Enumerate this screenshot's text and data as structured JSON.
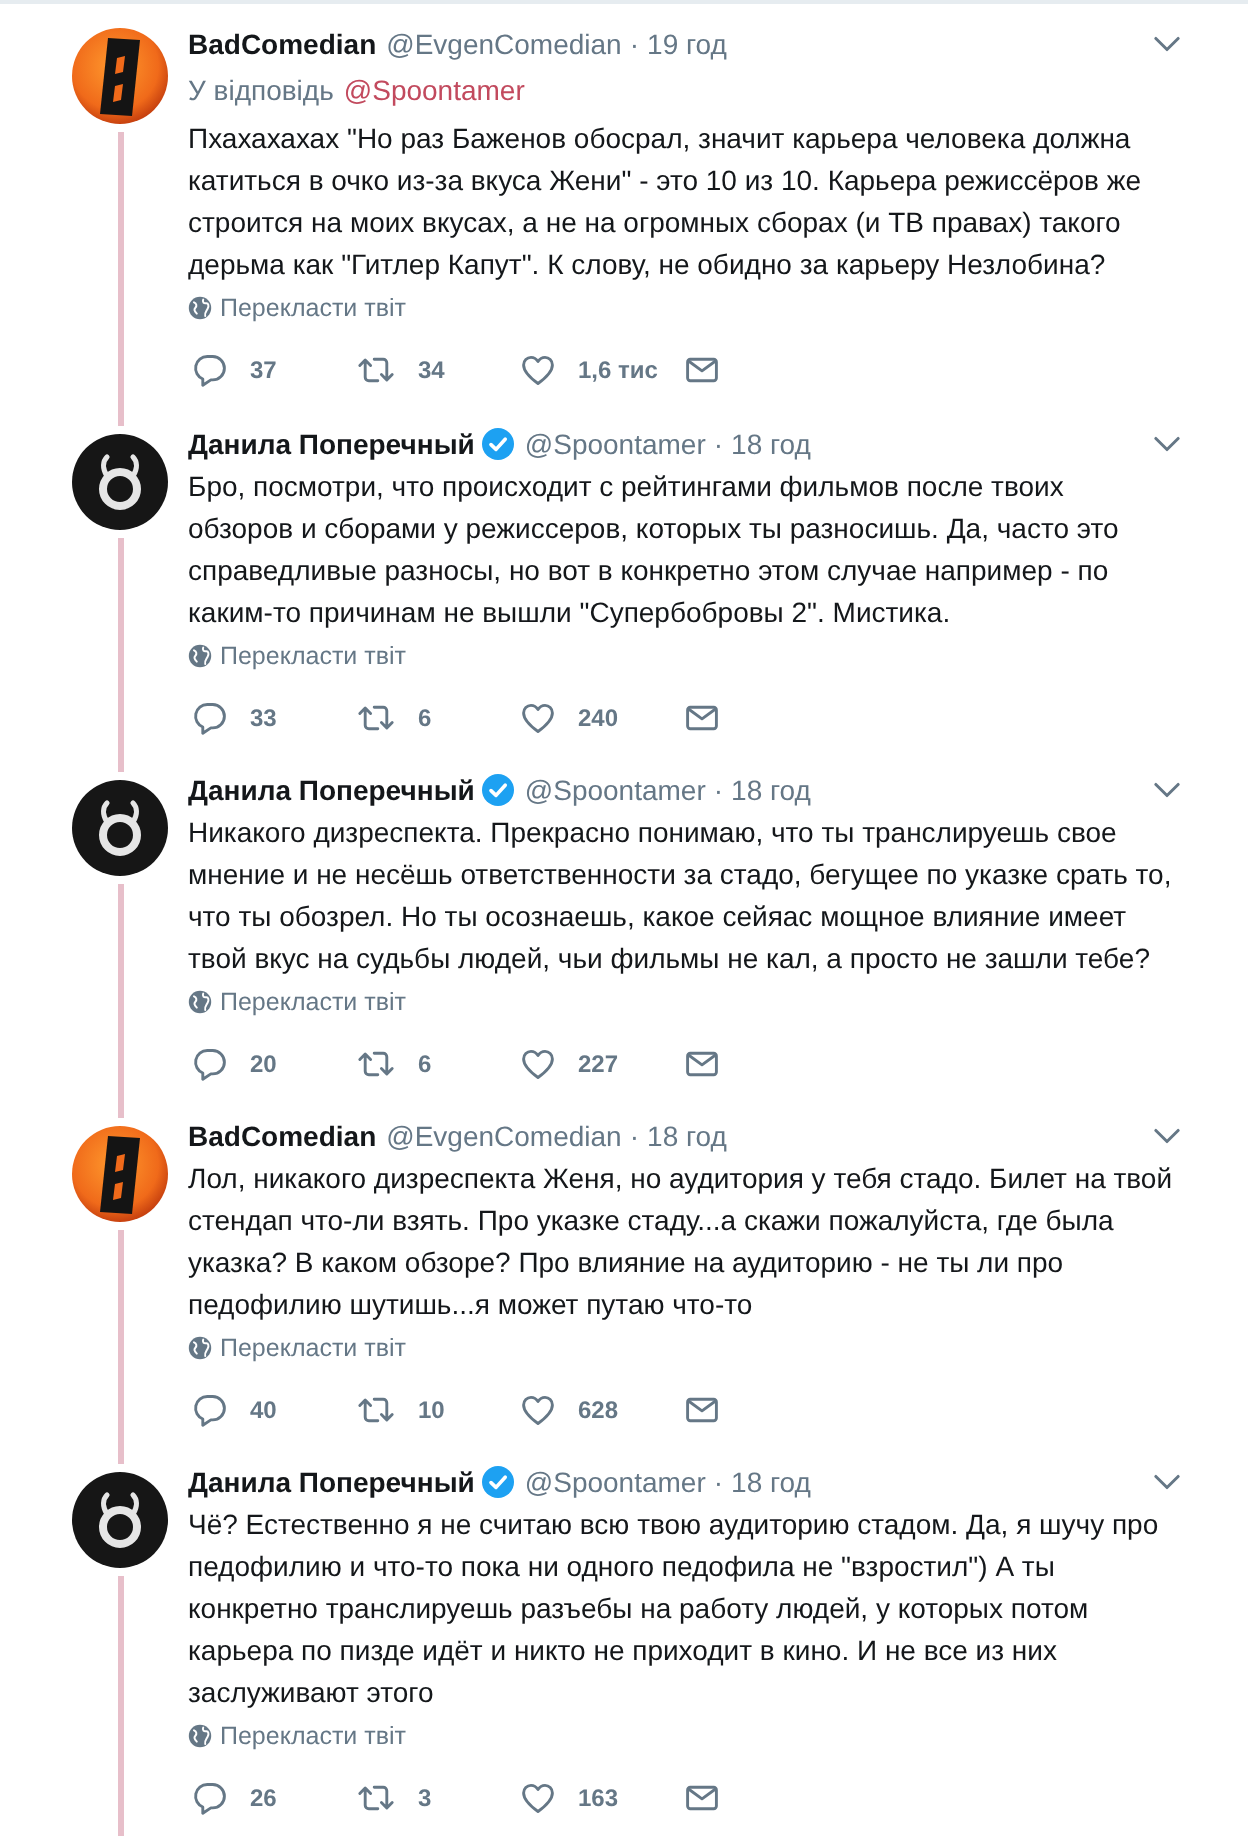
{
  "tweets": [
    {
      "avatar": {
        "kind": "orange-block"
      },
      "name": "BadComedian",
      "verified": false,
      "handle": "@EvgenComedian",
      "dot": "·",
      "time": "19 год",
      "reply_to": {
        "label": "У відповідь",
        "mention": "@Spoontamer"
      },
      "text": "Пхахахахах \"Но раз Баженов обосрал, значит карьера человека должна катиться в очко из-за вкуса Жени\" - это 10 из 10. Карьера режиссёров же строится на моих вкусах, а не на огромных сборах (и ТВ правах) такого дерьма как \"Гитлер Капут\". К слову, не обидно за карьеру Незлобина?",
      "translate": "Перекласти твіт",
      "actions": [
        {
          "kind": "reply",
          "count": "37"
        },
        {
          "kind": "retweet",
          "count": "34"
        },
        {
          "kind": "like",
          "count": "1,6 тис"
        },
        {
          "kind": "message"
        }
      ]
    },
    {
      "avatar": {
        "kind": "ring"
      },
      "name": "Данила Поперечный",
      "verified": true,
      "handle": "@Spoontamer",
      "dot": "·",
      "time": "18 год",
      "text": "Бро, посмотри, что происходит с рейтингами фильмов после твоих обзоров и сборами у режиссеров, которых ты разносишь. Да, часто это справедливые разносы, но вот в конкретно этом случае например - по каким-то причинам не вышли \"Супербобровы 2\". Мистика.",
      "translate": "Перекласти твіт",
      "actions": [
        {
          "kind": "reply",
          "count": "33"
        },
        {
          "kind": "retweet",
          "count": "6"
        },
        {
          "kind": "like",
          "count": "240"
        },
        {
          "kind": "message"
        }
      ]
    },
    {
      "avatar": {
        "kind": "ring"
      },
      "name": "Данила Поперечный",
      "verified": true,
      "handle": "@Spoontamer",
      "dot": "·",
      "time": "18 год",
      "text": "Никакого дизреспекта. Прекрасно понимаю, что ты транслируешь свое мнение и не несёшь ответственности за стадо, бегущее по указке срать то, что ты обозрел. Но ты осознаешь, какое сейяас мощное влияние имеет твой вкус на судьбы людей, чьи фильмы не кал, а просто не зашли тебе?",
      "translate": "Перекласти твіт",
      "actions": [
        {
          "kind": "reply",
          "count": "20"
        },
        {
          "kind": "retweet",
          "count": "6"
        },
        {
          "kind": "like",
          "count": "227"
        },
        {
          "kind": "message"
        }
      ]
    },
    {
      "avatar": {
        "kind": "orange-block"
      },
      "name": "BadComedian",
      "verified": false,
      "handle": "@EvgenComedian",
      "dot": "·",
      "time": "18 год",
      "text": "Лол, никакого дизреспекта Женя, но аудитория у тебя стадо. Билет на твой стендап что-ли взять. Про указке стаду...а скажи пожалуйста, где была указка? В каком обзоре? Про влияние на аудиторию - не ты ли про педофилию шутишь...я может путаю что-то",
      "translate": "Перекласти твіт",
      "actions": [
        {
          "kind": "reply",
          "count": "40"
        },
        {
          "kind": "retweet",
          "count": "10"
        },
        {
          "kind": "like",
          "count": "628"
        },
        {
          "kind": "message"
        }
      ]
    },
    {
      "avatar": {
        "kind": "ring"
      },
      "name": "Данила Поперечный",
      "verified": true,
      "handle": "@Spoontamer",
      "dot": "·",
      "time": "18 год",
      "text": "Чё? Естественно я не считаю всю твою аудиторию стадом. Да, я шучу про педофилию и что-то пока ни одного педофила не \"взростил\") А ты конкретно транслируешь разъебы на работу людей, у которых потом карьера по пизде идёт и никто не приходит в кино. И не все из них заслуживают этого",
      "translate": "Перекласти твіт",
      "actions": [
        {
          "kind": "reply",
          "count": "26"
        },
        {
          "kind": "retweet",
          "count": "3"
        },
        {
          "kind": "like",
          "count": "163"
        },
        {
          "kind": "message"
        }
      ]
    }
  ]
}
